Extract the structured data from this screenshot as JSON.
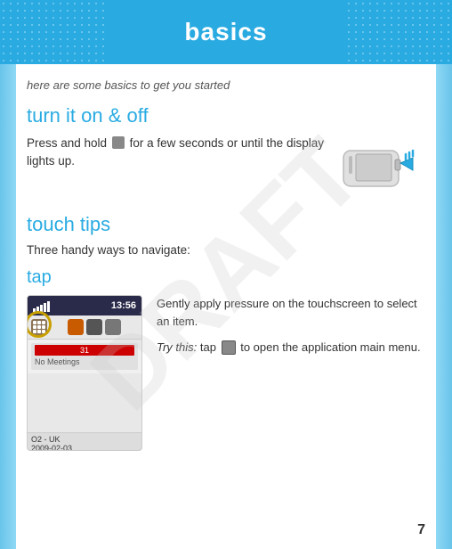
{
  "header": {
    "title": "basics",
    "dots_left": true,
    "dots_right": true
  },
  "content": {
    "subtitle": "here are some basics to get you started",
    "section_on_off": {
      "title": "turn it on & off",
      "body": "Press and hold",
      "body2": "for a few seconds or until the display lights up."
    },
    "section_touch_tips": {
      "title": "touch tips",
      "subtitle": "Three handy ways to navigate:"
    },
    "section_tap": {
      "title": "tap",
      "description": "Gently apply pressure on the touchscreen to select an item.",
      "try_this_prefix": "Try this:",
      "try_this_action": "tap",
      "try_this_suffix": "to open the application main menu."
    }
  },
  "phone_screen": {
    "time": "13:56",
    "operator": "O2 - UK",
    "date": "2009-02-03",
    "meeting_text": "No Meetings",
    "day": "31"
  },
  "page_number": "7",
  "watermark": "DRAFT"
}
